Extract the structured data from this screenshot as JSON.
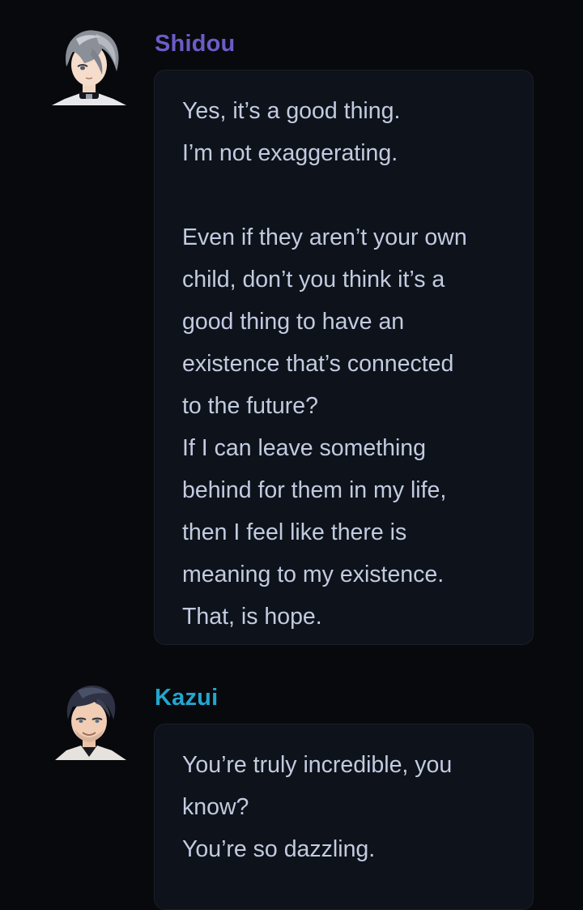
{
  "messages": [
    {
      "speaker": "Shidou",
      "name_color": "#6d5bc8",
      "lines": [
        "Yes, it’s a good thing.",
        "I’m not exaggerating.",
        "",
        "Even if they aren’t your own",
        "child, don’t you think it’s a",
        "good thing to have an",
        "existence that’s connected",
        "to the future?",
        "If I can leave something",
        "behind for them in my life,",
        "then I feel like there is",
        "meaning to my existence.",
        "That, is hope."
      ]
    },
    {
      "speaker": "Kazui",
      "name_color": "#22a6cf",
      "lines": [
        "You’re truly incredible, you",
        "know?",
        "You’re so dazzling."
      ]
    }
  ]
}
